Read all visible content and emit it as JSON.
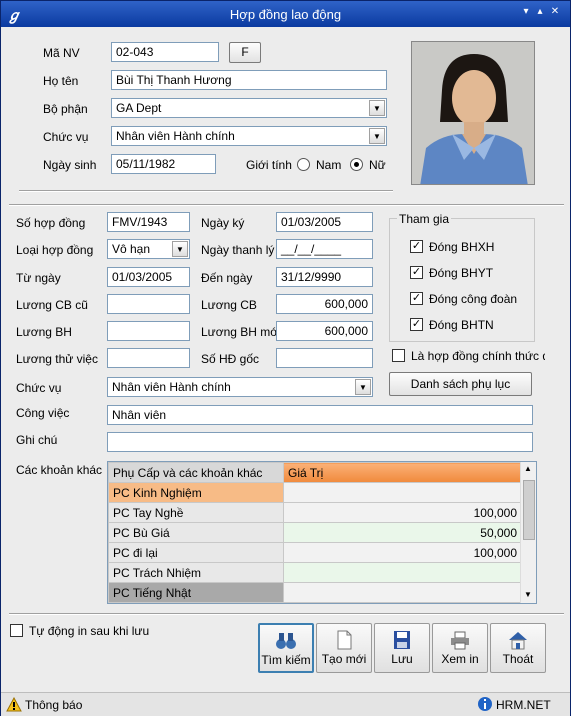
{
  "window": {
    "title": "Hợp đồng lao động"
  },
  "employee": {
    "ma_nv_label": "Mã NV",
    "ma_nv": "02-043",
    "f_button": "F",
    "ho_ten_label": "Họ tên",
    "ho_ten": "Bùi Thị Thanh Hương",
    "bo_phan_label": "Bộ phận",
    "bo_phan": "GA Dept",
    "chuc_vu_label": "Chức vụ",
    "chuc_vu": "Nhân viên Hành chính",
    "ngay_sinh_label": "Ngày sinh",
    "ngay_sinh": "05/11/1982",
    "gioi_tinh_label": "Giới tính",
    "nam": "Nam",
    "nu": "Nữ",
    "gender_selected": "Nữ"
  },
  "contract": {
    "so_hop_dong_label": "Số hợp đồng",
    "so_hop_dong": "FMV/1943",
    "ngay_ky_label": "Ngày ký",
    "ngay_ky": "01/03/2005",
    "loai_hop_dong_label": "Loại hợp đồng",
    "loai_hop_dong": "Vô hạn",
    "ngay_thanh_ly_label": "Ngày thanh lý",
    "ngay_thanh_ly": "__/__/____",
    "tu_ngay_label": "Từ ngày",
    "tu_ngay": "01/03/2005",
    "den_ngay_label": "Đến ngày",
    "den_ngay": "31/12/9990",
    "luong_cb_cu_label": "Lương CB cũ",
    "luong_cb_cu": "",
    "luong_cb_label": "Lương CB",
    "luong_cb": "600,000",
    "luong_bh_label": "Lương BH",
    "luong_bh": "",
    "luong_bh_moi_label": "Lương BH mới",
    "luong_bh_moi": "600,000",
    "luong_thu_viec_label": "Lương thử việc",
    "luong_thu_viec": "",
    "so_hd_goc_label": "Số HĐ gốc",
    "so_hd_goc": "",
    "chuc_vu_label": "Chức vụ",
    "chuc_vu": "Nhân viên Hành chính",
    "cong_viec_label": "Công việc",
    "cong_viec": "Nhân viên",
    "ghi_chu_label": "Ghi chú",
    "ghi_chu": "",
    "cac_khoan_khac_label": "Các khoản khác"
  },
  "tham_gia": {
    "title": "Tham gia",
    "items": [
      {
        "label": "Đóng BHXH",
        "checked": true
      },
      {
        "label": "Đóng BHYT",
        "checked": true
      },
      {
        "label": "Đóng công đoàn",
        "checked": true
      },
      {
        "label": "Đóng BHTN",
        "checked": true
      }
    ],
    "official_label": "Là hợp đồng chính thức đầu",
    "danh_sach_button": "Danh sách phụ lục"
  },
  "allowances": {
    "headers": [
      "Phụ Cấp và các khoản khác",
      "Giá Trị"
    ],
    "rows": [
      {
        "name": "PC Kinh Nghiệm",
        "value": ""
      },
      {
        "name": "PC Tay Nghề",
        "value": "100,000"
      },
      {
        "name": "PC Bù Giá",
        "value": "50,000"
      },
      {
        "name": "PC đi lại",
        "value": "100,000"
      },
      {
        "name": "PC Trách Nhiệm",
        "value": ""
      },
      {
        "name": "PC Tiếng Nhật",
        "value": ""
      }
    ]
  },
  "auto_print_label": "Tự động in sau khi lưu",
  "toolbar": {
    "search": "Tìm kiếm",
    "new": "Tạo mới",
    "save": "Lưu",
    "preview": "Xem in",
    "exit": "Thoát"
  },
  "status": {
    "left": "Thông báo",
    "right": "HRM.NET"
  },
  "icons": {
    "title": "app-logo-icon",
    "search": "binoculars-icon",
    "new": "new-document-icon",
    "save": "floppy-disk-icon",
    "preview": "printer-icon",
    "exit": "home-icon",
    "warning": "warning-icon",
    "info": "info-icon"
  }
}
